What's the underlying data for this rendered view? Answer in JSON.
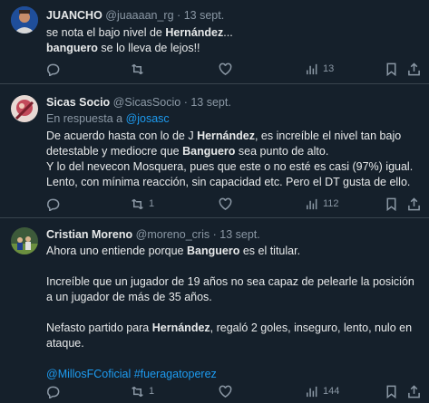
{
  "tweets": [
    {
      "name": "JUANCHO",
      "handle": "@juaaaan_rg",
      "dot": "·",
      "time": "13 sept.",
      "line1_a": "se nota el bajo nivel de ",
      "line1_b": "Hernández",
      "line1_c": "...",
      "line2_a": "banguero",
      "line2_b": " se lo lleva de lejos!!",
      "replies": "",
      "retweets": "",
      "likes": "",
      "views": "13"
    },
    {
      "name": "Sicas Socio",
      "handle": "@SicasSocio",
      "dot": "·",
      "time": "13 sept.",
      "reply_prefix": "En respuesta a ",
      "reply_handle": "@josasc",
      "l1_a": "De acuerdo hasta con lo de J ",
      "l1_b": "Hernández",
      "l1_c": ", es increíble el nivel tan bajo",
      "l2_a": "detestable y mediocre que ",
      "l2_b": "Banguero",
      "l2_c": " sea punto de alto.",
      "l3": "Y lo del nevecon Mosquera, pues que este o no esté es casi (97%) igual.",
      "l4": "Lento, con mínima reacción, sin capacidad etc. Pero el DT gusta de ello.",
      "replies": "",
      "retweets": "1",
      "likes": "",
      "views": "112"
    },
    {
      "name": "Cristian Moreno",
      "handle": "@moreno_cris",
      "dot": "·",
      "time": "13 sept.",
      "p1_a": "Ahora uno entiende porque ",
      "p1_b": "Banguero",
      "p1_c": " es el titular.",
      "p2": "Increíble que un jugador de 19 años no sea capaz de pelearle la posición a un jugador de más de 35 años.",
      "p3_a": "Nefasto partido para  ",
      "p3_b": "Hernández",
      "p3_c": ", regaló 2 goles, inseguro, lento, nulo en ataque.",
      "tags": "@MillosFCoficial #fueragatoperez",
      "replies": "",
      "retweets": "1",
      "likes": "",
      "views": "144"
    }
  ],
  "colors": {
    "background": "#15202b",
    "divider": "#38444d",
    "text": "#e7e9ea",
    "muted": "#8b98a5",
    "link": "#1d9bf0"
  },
  "icons": [
    "reply-icon",
    "retweet-icon",
    "like-icon",
    "views-icon",
    "bookmark-icon",
    "share-icon"
  ]
}
